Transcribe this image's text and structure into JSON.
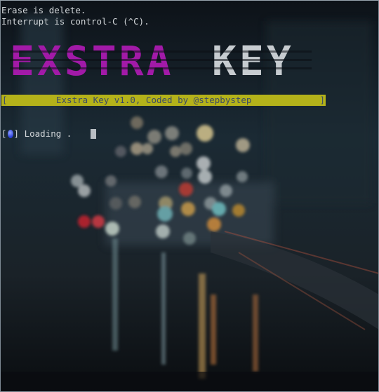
{
  "terminal": {
    "line1": "Erase is delete.",
    "line2": "Interrupt is control-C (^C)."
  },
  "logo": {
    "part1": "EXSTRA",
    "part2": "KEY",
    "color1": "#a21aa8",
    "color2": "#c7ccd0"
  },
  "banner": {
    "left_bracket": "[",
    "text": "Exstra Key v1.0, Coded by @stepbystep",
    "right_bracket": "]",
    "bg_color": "#b4b21a"
  },
  "loading": {
    "open_bracket": "[",
    "close_bracket": "]",
    "text": "Loading ."
  }
}
